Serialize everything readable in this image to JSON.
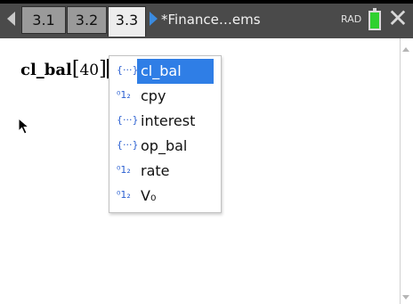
{
  "tabs": [
    {
      "label": "3.1"
    },
    {
      "label": "3.2"
    },
    {
      "label": "3.3"
    }
  ],
  "document_title": "*Finance…ems",
  "mode_indicator": "RAD",
  "icons": {
    "prev_tab": "left-arrow-icon",
    "doc_menu": "right-arrow-icon",
    "battery": "battery-icon",
    "close": "close-icon"
  },
  "colors": {
    "selection": "#2f7ee6",
    "battery_fill": "#2fd12f",
    "active_tab_bg": "#ededed",
    "titlebar_bg": "#4a4a4a"
  },
  "expression": {
    "function_name": "cl_bal",
    "open_bracket": "[",
    "argument": "40",
    "close_bracket": "]"
  },
  "autocomplete": {
    "selected_index": 0,
    "items": [
      {
        "icon_text": "{···}",
        "kind": "function",
        "label": "cl_bal"
      },
      {
        "icon_text": "⁰1₂",
        "kind": "variable",
        "label": "cpy"
      },
      {
        "icon_text": "{···}",
        "kind": "function",
        "label": "interest"
      },
      {
        "icon_text": "{···}",
        "kind": "function",
        "label": "op_bal"
      },
      {
        "icon_text": "⁰1₂",
        "kind": "variable",
        "label": "rate"
      },
      {
        "icon_text": "⁰1₂",
        "kind": "variable",
        "label": "V₀"
      }
    ]
  }
}
